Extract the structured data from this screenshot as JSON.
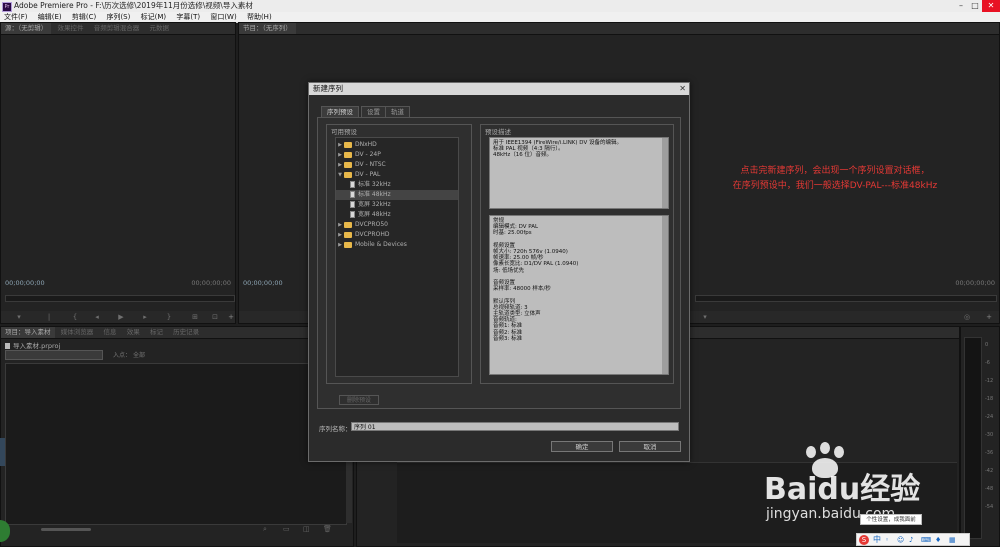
{
  "app": {
    "title": "Adobe Premiere Pro - F:\\历次选修\\2019年11月份选修\\视频\\导入素材"
  },
  "menu": [
    "文件(F)",
    "编辑(E)",
    "剪辑(C)",
    "序列(S)",
    "标记(M)",
    "字幕(T)",
    "窗口(W)",
    "帮助(H)"
  ],
  "source_panel": {
    "tabs": [
      "源：（无剪辑）",
      "效果控件",
      "音频剪辑混合器",
      "元数据"
    ],
    "timecode_left": "00;00;00;00",
    "timecode_right": "00;00;00;00"
  },
  "program_panel": {
    "tabs": [
      "节目：（无序列）"
    ],
    "timecode_left": "00;00;00;00",
    "timecode_right": "00;00;00;00"
  },
  "project_panel": {
    "tabs": [
      "项目：导入素材",
      "媒体浏览器",
      "信息",
      "效果",
      "标记",
      "历史记录"
    ],
    "file": "导入素材.prproj",
    "search_label": "入点：",
    "search_value": "全部"
  },
  "annotation": {
    "line1": "点击完新建序列，会出现一个序列设置对话框，",
    "line2": "在序列预设中，我们一般选择DV-PAL---标准48kHz"
  },
  "audio_meter_labels": [
    "0",
    "-6",
    "-12",
    "-18",
    "-24",
    "-30",
    "-36",
    "-42",
    "-48",
    "-54"
  ],
  "dialog": {
    "title": "新建序列",
    "tabs": [
      "序列预设",
      "设置",
      "轨道"
    ],
    "available_label": "可用预设",
    "description_label": "预设描述",
    "tree": [
      {
        "label": "DNxHD",
        "level": 0,
        "type": "folder",
        "open": false
      },
      {
        "label": "DV - 24P",
        "level": 0,
        "type": "folder",
        "open": false
      },
      {
        "label": "DV - NTSC",
        "level": 0,
        "type": "folder",
        "open": false
      },
      {
        "label": "DV - PAL",
        "level": 0,
        "type": "folder",
        "open": true
      },
      {
        "label": "标准 32kHz",
        "level": 1,
        "type": "file"
      },
      {
        "label": "标准 48kHz",
        "level": 1,
        "type": "file",
        "selected": true
      },
      {
        "label": "宽屏 32kHz",
        "level": 1,
        "type": "file"
      },
      {
        "label": "宽屏 48kHz",
        "level": 1,
        "type": "file"
      },
      {
        "label": "DVCPRO50",
        "level": 0,
        "type": "folder",
        "open": false
      },
      {
        "label": "DVCPROHD",
        "level": 0,
        "type": "folder",
        "open": false
      },
      {
        "label": "Mobile & Devices",
        "level": 0,
        "type": "folder",
        "open": false
      }
    ],
    "description_lines": [
      "用于 IEEE1394 (FireWire/i.LINK) DV 设备的编辑。",
      "标准 PAL 视频（4:3 隔行）。",
      "48kHz（16 位）音频。"
    ],
    "details_lines": [
      "常规",
      "  编辑模式: DV PAL",
      "  时基: 25.00fps",
      "",
      "视频设置",
      "  帧大小: 720h 576v (1.0940)",
      "  帧速率: 25.00 帧/秒",
      "  像素长宽比: D1/DV PAL (1.0940)",
      "  场: 低场优先",
      "",
      "音频设置",
      "  采样率: 48000 样本/秒",
      "",
      "默认序列",
      "  总视频轨道: 3",
      "  主轨道类型: 立体声",
      "  音频轨道:",
      "  音频1: 标准",
      "  音频2: 标准",
      "  音频3: 标准"
    ],
    "delete_preset_label": "删除预设",
    "sequence_name_label": "序列名称：",
    "sequence_name_value": "序列 01",
    "ok_label": "确定",
    "cancel_label": "取消"
  },
  "watermark": {
    "brand": "Baidu经验",
    "url": "jingyan.baidu.com"
  },
  "ime_tooltip": "个性设置，成我面前",
  "ime_label": "中"
}
